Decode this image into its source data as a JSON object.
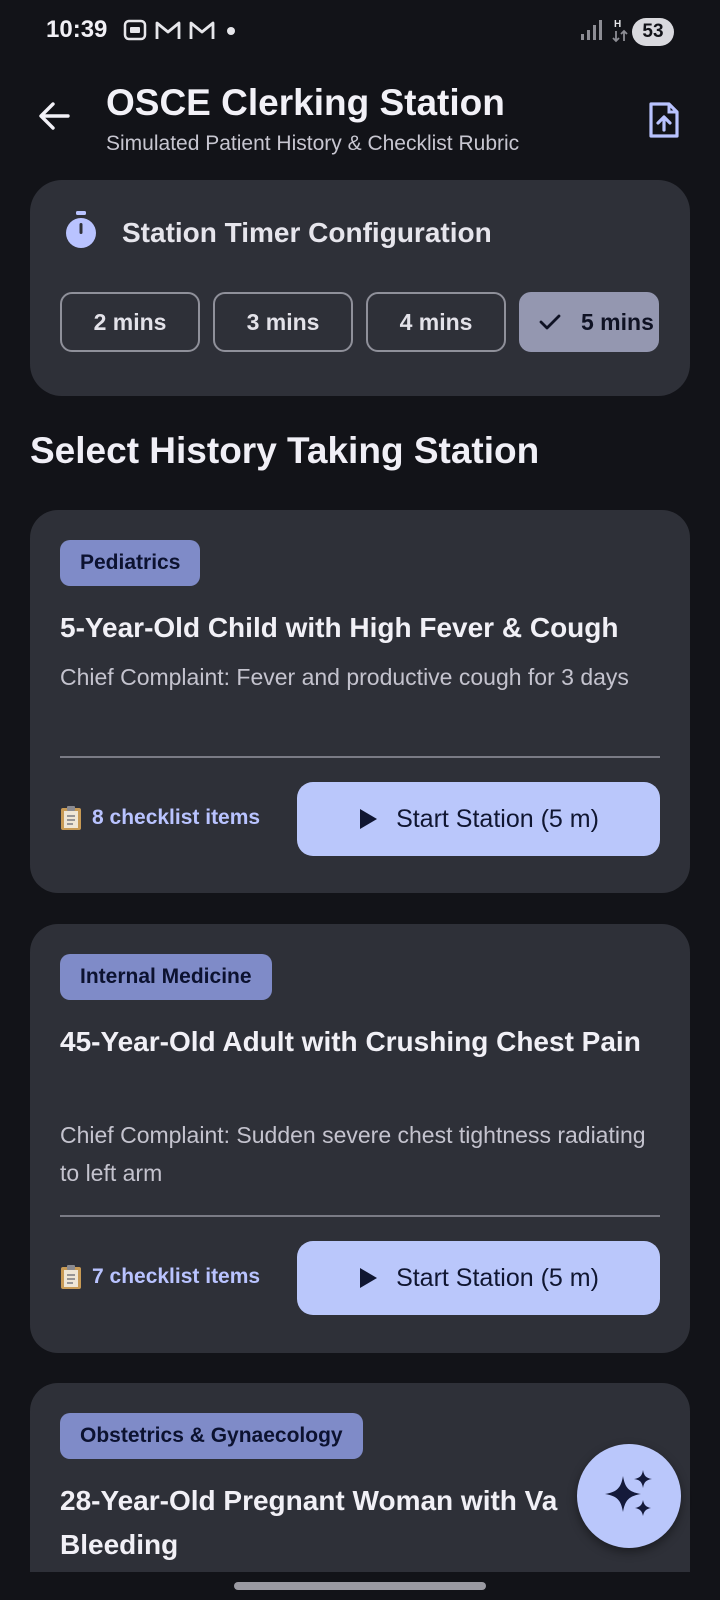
{
  "status_bar": {
    "time": "10:39",
    "battery": "53",
    "icons": [
      "screenshot-icon",
      "gmail-icon",
      "gmail-icon",
      "dot-icon",
      "signal-icon",
      "data-arrows-icon",
      "signal-icon"
    ]
  },
  "app_bar": {
    "title": "OSCE Clerking Station",
    "subtitle": "Simulated Patient History & Checklist Rubric"
  },
  "timer": {
    "label": "Station Timer Configuration",
    "options": [
      "2 mins",
      "3 mins",
      "4 mins",
      "5 mins"
    ],
    "selected": "5 mins"
  },
  "section_title": "Select History Taking Station",
  "cases": [
    {
      "tag": "Pediatrics",
      "title": "5-Year-Old Child with High Fever & Cough",
      "complaint": "Chief Complaint: Fever and productive cough for 3 days",
      "checklist": "8 checklist items",
      "button": "Start Station (5 m)"
    },
    {
      "tag": "Internal Medicine",
      "title": "45-Year-Old Adult with Crushing Chest Pain",
      "complaint": "Chief Complaint: Sudden severe chest tightness radiating to left arm",
      "checklist": "7 checklist items",
      "button": "Start Station (5 m)"
    },
    {
      "tag": "Obstetrics & Gynaecology",
      "title": "28-Year-Old Pregnant Woman with Va Bleeding"
    }
  ],
  "colors": {
    "background": "#121318",
    "card": "#2e3038",
    "primary_container": "#bac7fb",
    "tag": "#7f8bc8",
    "accent_text": "#b9c3ff"
  }
}
